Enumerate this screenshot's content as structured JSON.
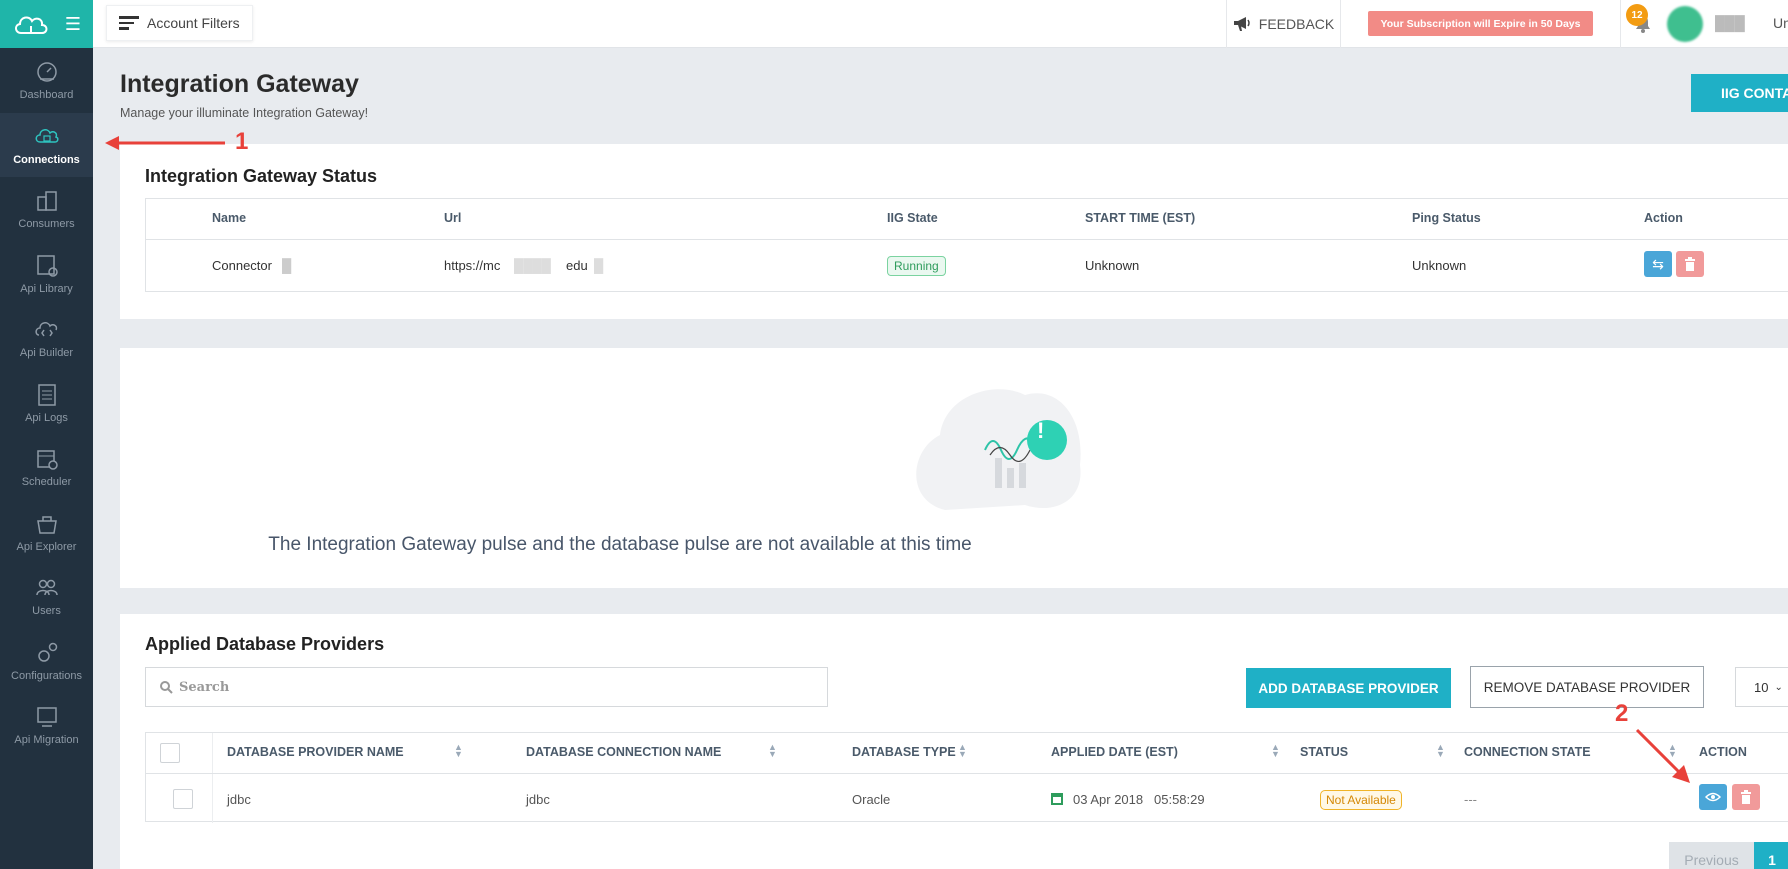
{
  "sidebar": {
    "items": [
      {
        "label": "Dashboard",
        "icon": "dashboard-icon"
      },
      {
        "label": "Connections",
        "icon": "connections-icon",
        "active": true
      },
      {
        "label": "Consumers",
        "icon": "consumers-icon"
      },
      {
        "label": "Api Library",
        "icon": "api-library-icon"
      },
      {
        "label": "Api Builder",
        "icon": "api-builder-icon"
      },
      {
        "label": "Api Logs",
        "icon": "api-logs-icon"
      },
      {
        "label": "Scheduler",
        "icon": "scheduler-icon"
      },
      {
        "label": "Api Explorer",
        "icon": "api-explorer-icon"
      },
      {
        "label": "Users",
        "icon": "users-icon"
      },
      {
        "label": "Configurations",
        "icon": "configurations-icon"
      },
      {
        "label": "Api Migration",
        "icon": "api-migration-icon"
      }
    ]
  },
  "topbar": {
    "account_filters": "Account Filters",
    "feedback": "FEEDBACK",
    "subscription_notice": "Your Subscription will Expire in 50 Days",
    "notification_count": "12",
    "user_name_tail": "Un"
  },
  "page": {
    "title": "Integration Gateway",
    "subtitle": "Manage your illuminate Integration Gateway!",
    "iig_button": "IIG CONTA"
  },
  "status_card": {
    "title": "Integration Gateway Status",
    "headers": {
      "name": "Name",
      "url": "Url",
      "state": "IIG State",
      "start_time": "START TIME (EST)",
      "ping": "Ping Status",
      "action": "Action"
    },
    "row": {
      "name": "Connector",
      "url_start": "https://mc",
      "url_mid": "edu",
      "state": "Running",
      "start_time": "Unknown",
      "ping": "Unknown"
    }
  },
  "pulse": {
    "message": "The Integration Gateway pulse and the database pulse are not available at this time",
    "alert_glyph": "!"
  },
  "providers": {
    "title": "Applied Database Providers",
    "search_placeholder": "Search",
    "add_button": "ADD DATABASE PROVIDER",
    "remove_button": "REMOVE DATABASE PROVIDER",
    "page_size": "10",
    "headers": {
      "provider_name": "DATABASE PROVIDER NAME",
      "connection_name": "DATABASE CONNECTION NAME",
      "type": "DATABASE TYPE",
      "applied_date": "APPLIED DATE (EST)",
      "status": "STATUS",
      "connection_state": "CONNECTION STATE",
      "action": "ACTION"
    },
    "row": {
      "provider_name": "jdbc",
      "connection_name": "jdbc",
      "type": "Oracle",
      "applied_date": "03 Apr 2018",
      "applied_time": "05:58:29",
      "status": "Not Available",
      "connection_state": "---"
    },
    "pager": {
      "previous": "Previous",
      "current": "1"
    }
  },
  "annotations": {
    "marker_1": "1",
    "marker_2": "2"
  },
  "colors": {
    "brand_teal": "#1fb5a9",
    "sidebar_bg": "#22313f",
    "button_cyan": "#1fb0c6",
    "annotation_red": "#e8413a",
    "subscription_bg": "#f28b86"
  }
}
